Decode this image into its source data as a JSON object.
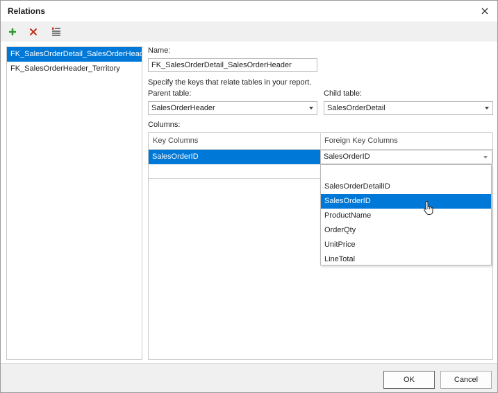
{
  "window": {
    "title": "Relations"
  },
  "toolbar": {
    "add_icon": "plus-icon",
    "delete_icon": "delete-x-icon",
    "clear_icon": "clear-list-icon",
    "colors": {
      "add": "#2e9a2e",
      "delete": "#c42b1c"
    }
  },
  "relations": {
    "items": [
      {
        "label": "FK_SalesOrderDetail_SalesOrderHeader"
      },
      {
        "label": "FK_SalesOrderHeader_Territory"
      }
    ],
    "selected_index": 0
  },
  "form": {
    "name_label": "Name:",
    "name_value": "FK_SalesOrderDetail_SalesOrderHeader",
    "hint": "Specify the keys that relate tables in your report.",
    "parent_label": "Parent table:",
    "parent_value": "SalesOrderHeader",
    "child_label": "Child table:",
    "child_value": "SalesOrderDetail",
    "columns_label": "Columns:"
  },
  "grid": {
    "headers": [
      "Key Columns",
      "Foreign Key Columns"
    ],
    "rows": [
      {
        "key": "SalesOrderID",
        "foreign_key": "SalesOrderID"
      }
    ]
  },
  "dropdown": {
    "options": [
      "",
      "SalesOrderDetailID",
      "SalesOrderID",
      "ProductName",
      "OrderQty",
      "UnitPrice",
      "LineTotal"
    ],
    "selected_index": 2
  },
  "footer": {
    "ok_label": "OK",
    "cancel_label": "Cancel"
  },
  "colors": {
    "selection": "#0078d7"
  }
}
